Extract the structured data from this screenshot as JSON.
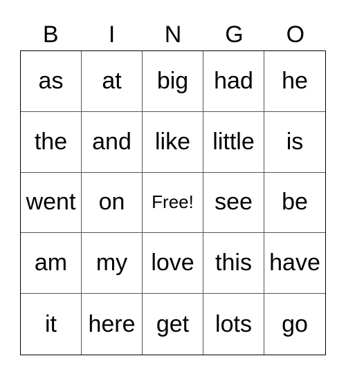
{
  "header": [
    "B",
    "I",
    "N",
    "G",
    "O"
  ],
  "rows": [
    [
      "as",
      "at",
      "big",
      "had",
      "he"
    ],
    [
      "the",
      "and",
      "like",
      "little",
      "is"
    ],
    [
      "went",
      "on",
      "Free!",
      "see",
      "be"
    ],
    [
      "am",
      "my",
      "love",
      "this",
      "have"
    ],
    [
      "it",
      "here",
      "get",
      "lots",
      "go"
    ]
  ]
}
